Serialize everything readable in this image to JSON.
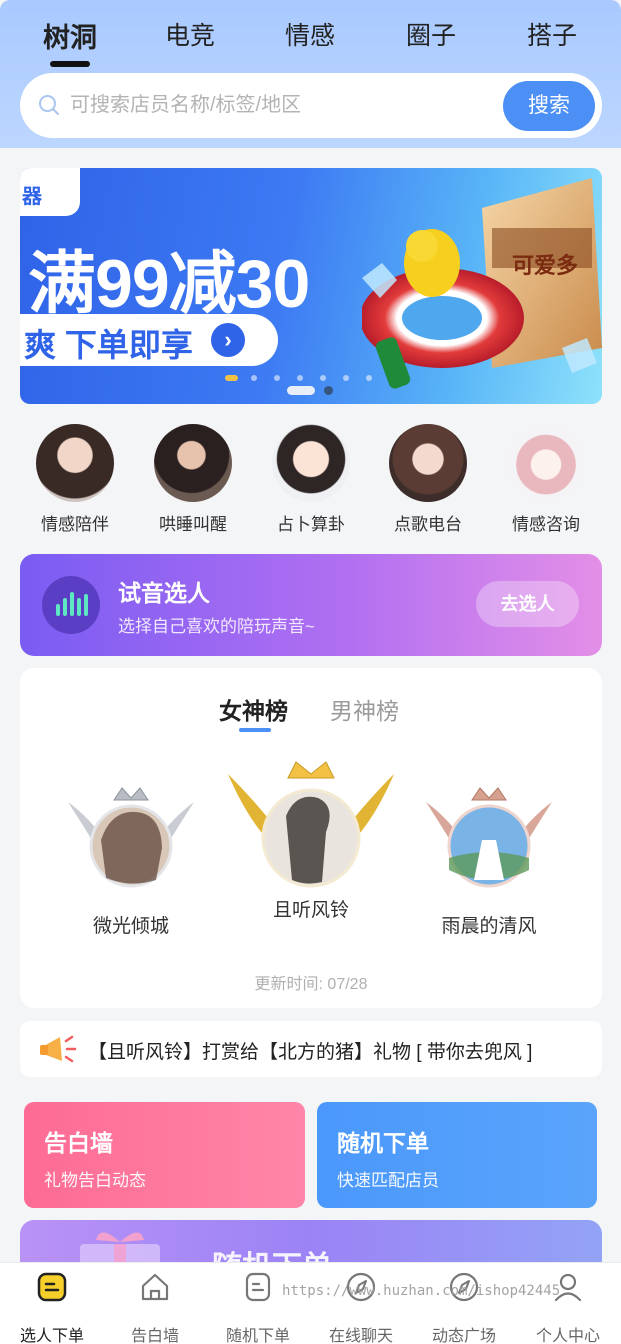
{
  "top_tabs": [
    "树洞",
    "电竞",
    "情感",
    "圈子",
    "搭子"
  ],
  "search": {
    "placeholder": "可搜索店员名称/标签/地区",
    "button": "搜索"
  },
  "banner": {
    "title": "满99减30",
    "cta": "爽 下单即享",
    "tag": "器",
    "slide_count": 7,
    "active_slide": 0
  },
  "categories": [
    "情感陪伴",
    "哄睡叫醒",
    "占卜算卦",
    "点歌电台",
    "情感咨询"
  ],
  "voice_select": {
    "title": "试音选人",
    "subtitle": "选择自己喜欢的陪玩声音~",
    "button": "去选人"
  },
  "ranking": {
    "tabs": [
      "女神榜",
      "男神榜"
    ],
    "active_tab": "女神榜",
    "first": "且听风铃",
    "second": "微光倾城",
    "third": "雨晨的清风",
    "updated": "更新时间: 07/28"
  },
  "notice": {
    "text": "【且听风铃】打赏给【北方的猪】礼物 [ 带你去兜风 ]"
  },
  "cards": [
    {
      "title": "告白墙",
      "subtitle": "礼物告白动态",
      "color": "#fc6f97"
    },
    {
      "title": "随机下单",
      "subtitle": "快速匹配店员",
      "color": "#4e9bfb"
    }
  ],
  "promo": {
    "title": "随机下单"
  },
  "bottom_nav": [
    {
      "label": "选人下单",
      "icon": "order-icon",
      "active": true
    },
    {
      "label": "告白墙",
      "icon": "home-icon",
      "active": false
    },
    {
      "label": "随机下单",
      "icon": "random-icon",
      "active": false
    },
    {
      "label": "在线聊天",
      "icon": "compass-icon",
      "active": false
    },
    {
      "label": "动态广场",
      "icon": "compass-icon",
      "active": false
    },
    {
      "label": "个人中心",
      "icon": "user-icon",
      "active": false
    }
  ],
  "watermark": "https://www.huzhan.com/ishop42445",
  "colors": {
    "accent": "#4c8ff5",
    "header": "#a9c9ff",
    "gold": "#f3c245"
  }
}
